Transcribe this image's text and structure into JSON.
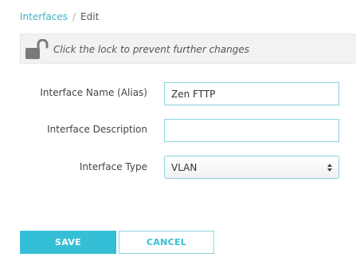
{
  "breadcrumb": {
    "parent": "Interfaces",
    "separator": "/",
    "current": "Edit"
  },
  "lock_bar": {
    "icon": "unlocked-padlock-icon",
    "message": "Click the lock to prevent further changes"
  },
  "form": {
    "interface_name": {
      "label": "Interface Name (Alias)",
      "value": "Zen FTTP"
    },
    "interface_description": {
      "label": "Interface Description",
      "value": ""
    },
    "interface_type": {
      "label": "Interface Type",
      "selected": "VLAN"
    }
  },
  "buttons": {
    "save": "SAVE",
    "cancel": "CANCEL"
  },
  "colors": {
    "accent": "#35bfd6",
    "link": "#3bb3c9",
    "field_border": "#8fd3e0",
    "lock_bar_bg": "#f2f2f2"
  }
}
